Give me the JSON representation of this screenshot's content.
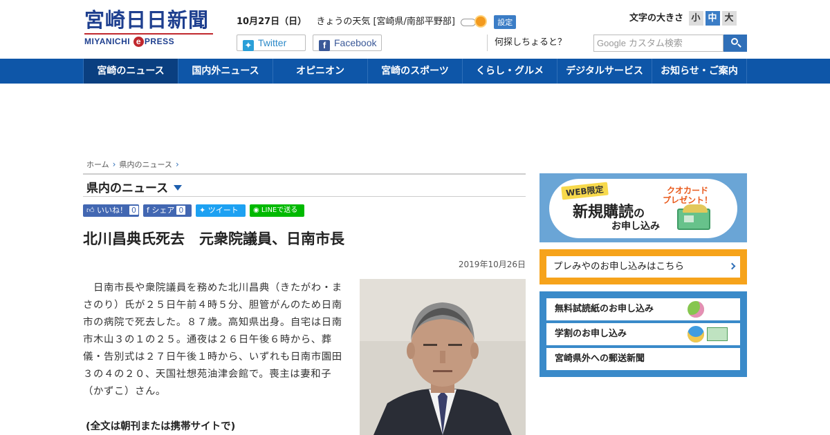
{
  "header": {
    "logo_main": "宮崎日日新聞",
    "logo_sub_left": "MIYANICHI",
    "logo_sub_e": "e",
    "logo_sub_right": "PRESS",
    "date": "10月27日（日）",
    "weather_text": "きょうの天気 [宮崎県/南部平野部]",
    "weather_icon": "cloudy-then-sunny-icon",
    "setting_label": "設定",
    "twitter_label": "Twitter",
    "facebook_label": "Facebook",
    "font_size_label": "文字の大きさ",
    "font_sizes": [
      "小",
      "中",
      "大"
    ],
    "font_size_selected": "中",
    "search_prompt": "何探しちょると？",
    "search_google": "Google",
    "search_placeholder": "カスタム検索"
  },
  "nav": {
    "items": [
      "宮崎のニュース",
      "国内外ニュース",
      "オピニオン",
      "宮崎のスポーツ",
      "くらし・グルメ",
      "デジタルサービス",
      "お知らせ・ご案内"
    ],
    "active": "宮崎のニュース"
  },
  "breadcrumb": [
    "ホーム",
    "県内のニュース"
  ],
  "section": {
    "title": "県内のニュース"
  },
  "share": {
    "like_label": "いいね！",
    "like_count": "0",
    "fb_label": "シェア",
    "fb_count": "0",
    "tweet_label": "ツイート",
    "line_label": "LINEで送る"
  },
  "article": {
    "title": "北川昌典氏死去　元衆院議員、日南市長",
    "date": "2019年10月26日",
    "body": "　日南市長や衆院議員を務めた北川昌典（きたがわ・まさのり）氏が２５日午前４時５分、胆管がんのため日南市の病院で死去した。８７歳。高知県出身。自宅は日南市木山３の１の２５。通夜は２６日午後６時から、葬儀・告別式は２７日午後１時から、いずれも日南市園田３の４の２０、天国社想苑油津会館で。喪主は妻和子（かずこ）さん。",
    "more": " (全文は朝刊または携帯サイトで)"
  },
  "sidebar": {
    "banner_web": "WEB限定",
    "banner_big": "新規購読",
    "banner_no": "の",
    "banner_small": "お申し込み",
    "banner_quo_1": "クオカード",
    "banner_quo_2": "プレゼント！",
    "premiyaya": "プレみやのお申し込みはこちら",
    "links": [
      "無料試読紙のお申し込み",
      "学割のお申し込み",
      "宮崎県外への郵送新聞"
    ]
  },
  "colors": {
    "nav_bg": "#0e56a8",
    "brand_blue": "#1e3f8f",
    "brand_red": "#c0272d",
    "sidebar_blue": "#3a8ac9",
    "sidebar_orange": "#f6a31b"
  }
}
